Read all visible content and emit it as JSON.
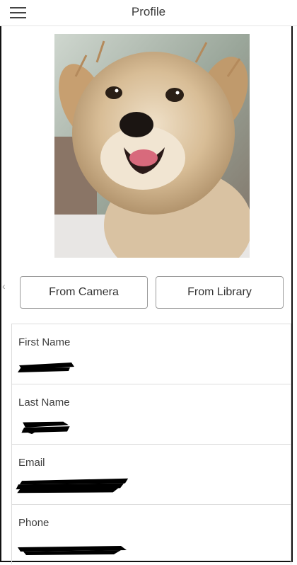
{
  "header": {
    "title": "Profile",
    "menu_icon": "hamburger-menu-icon"
  },
  "photo": {
    "description_icon": "profile-photo"
  },
  "buttons": {
    "camera_label": "From Camera",
    "library_label": "From Library"
  },
  "form": {
    "fields": [
      {
        "label": "First Name"
      },
      {
        "label": "Last Name"
      },
      {
        "label": "Email"
      },
      {
        "label": "Phone"
      }
    ]
  },
  "colors": {
    "border": "#dcdcdc",
    "text": "#333333",
    "redaction": "#000000"
  }
}
